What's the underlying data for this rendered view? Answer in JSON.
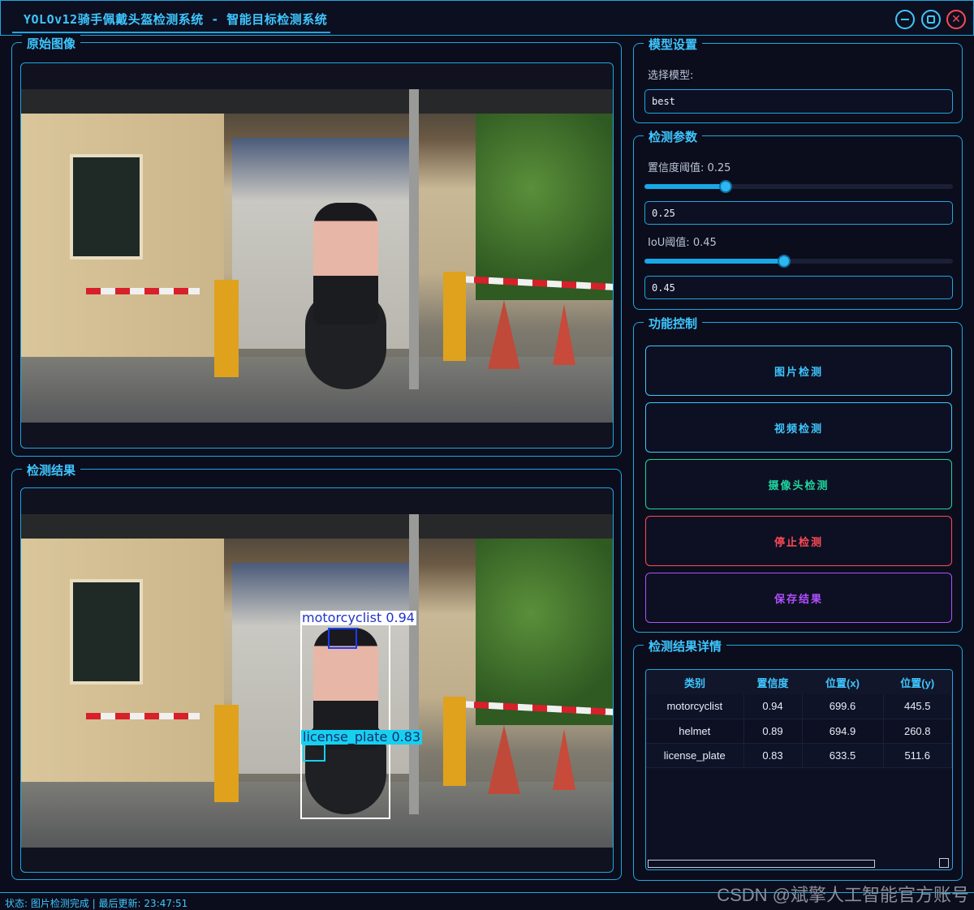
{
  "window": {
    "title": "YOLOv12骑手佩戴头盔检测系统 - 智能目标检测系统",
    "minimize_icon": "minimize-icon",
    "maximize_icon": "maximize-icon",
    "close_icon": "close-icon"
  },
  "original_panel": {
    "title": "原始图像"
  },
  "result_panel": {
    "title": "检测结果",
    "detections": [
      {
        "label": "motorcyclist 0.94",
        "color": "#ffffff",
        "label_bg": "#ffffff",
        "label_color": "#2032c8"
      },
      {
        "label": "license_plate 0.83",
        "color": "#16d0f0",
        "label_bg": "#16d0f0",
        "label_color": "#1b2a6a"
      },
      {
        "label": "",
        "color": "#1a3cff"
      }
    ]
  },
  "model_settings": {
    "title": "模型设置",
    "select_label": "选择模型:",
    "model_value": "best"
  },
  "params": {
    "title": "检测参数",
    "conf_label": "置信度阈值: 0.25",
    "conf_value": 0.25,
    "conf_input": "0.25",
    "iou_label": "IoU阈值: 0.45",
    "iou_value": 0.45,
    "iou_input": "0.45"
  },
  "controls": {
    "title": "功能控制",
    "buttons": [
      {
        "label": "图片检测",
        "color": "#3ec6ff"
      },
      {
        "label": "视频检测",
        "color": "#3ec6ff"
      },
      {
        "label": "摄像头检测",
        "color": "#20d4a0"
      },
      {
        "label": "停止检测",
        "color": "#ff4a55"
      },
      {
        "label": "保存结果",
        "color": "#b050ff"
      }
    ]
  },
  "details": {
    "title": "检测结果详情",
    "columns": [
      "类别",
      "置信度",
      "位置(x)",
      "位置(y)"
    ],
    "rows": [
      [
        "motorcyclist",
        "0.94",
        "699.6",
        "445.5"
      ],
      [
        "helmet",
        "0.89",
        "694.9",
        "260.8"
      ],
      [
        "license_plate",
        "0.83",
        "633.5",
        "511.6"
      ]
    ]
  },
  "status": {
    "text": "状态: 图片检测完成 | 最后更新: 23:47:51"
  },
  "watermark": "CSDN @斌擎人工智能官方账号",
  "colors": {
    "accent": "#1ea7e0",
    "background": "#0b0d1c"
  }
}
